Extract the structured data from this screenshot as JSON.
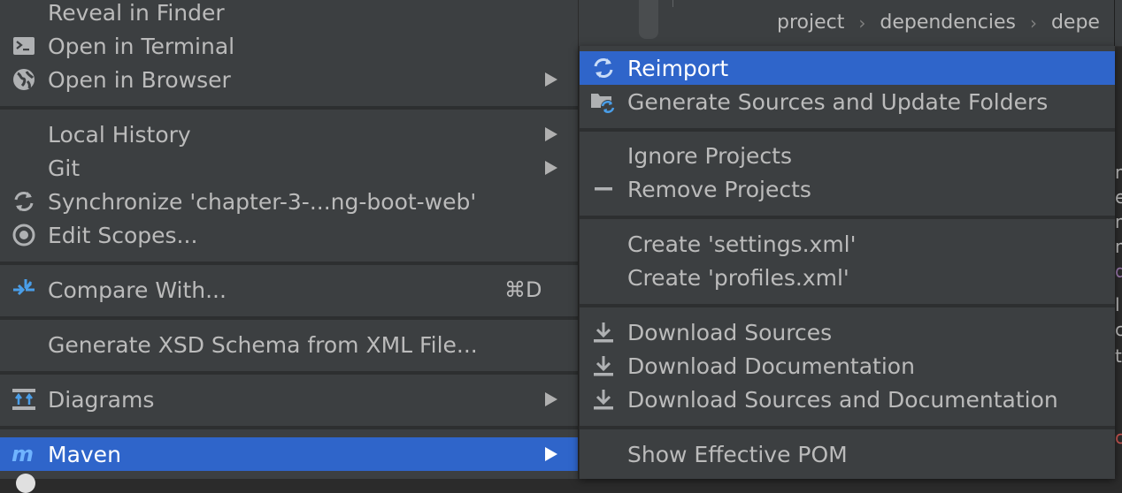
{
  "breadcrumb": [
    "project",
    "dependencies",
    "depe"
  ],
  "main_menu": {
    "items": [
      {
        "label": "Reveal in Finder",
        "icon": "",
        "submenu": false
      },
      {
        "label": "Open in Terminal",
        "icon": "terminal-icon",
        "submenu": false
      },
      {
        "label": "Open in Browser",
        "icon": "globe-icon",
        "submenu": true
      },
      {
        "label": "Local History",
        "icon": "",
        "submenu": true
      },
      {
        "label": "Git",
        "icon": "",
        "submenu": true
      },
      {
        "label": "Synchronize 'chapter-3-...ng-boot-web'",
        "icon": "sync-icon",
        "submenu": false
      },
      {
        "label": "Edit Scopes...",
        "icon": "scope-icon",
        "submenu": false
      },
      {
        "label": "Compare With...",
        "icon": "compare-icon",
        "submenu": false,
        "shortcut": "⌘D"
      },
      {
        "label": "Generate XSD Schema from XML File...",
        "icon": "",
        "submenu": false
      },
      {
        "label": "Diagrams",
        "icon": "diagram-icon",
        "submenu": true
      },
      {
        "label": "Maven",
        "icon": "maven-icon",
        "submenu": true,
        "selected": true
      }
    ]
  },
  "maven_menu": {
    "items": [
      {
        "label": "Reimport",
        "icon": "reimport-icon",
        "selected": true
      },
      {
        "label": "Generate Sources and Update Folders",
        "icon": "generate-sources-icon"
      },
      {
        "label": "Ignore Projects",
        "icon": ""
      },
      {
        "label": "Remove Projects",
        "icon": "minus-icon"
      },
      {
        "label": "Create 'settings.xml'",
        "icon": ""
      },
      {
        "label": "Create 'profiles.xml'",
        "icon": ""
      },
      {
        "label": "Download Sources",
        "icon": "download-icon"
      },
      {
        "label": "Download Documentation",
        "icon": "download-icon"
      },
      {
        "label": "Download Sources and Documentation",
        "icon": "download-icon"
      },
      {
        "label": "Show Effective POM",
        "icon": ""
      }
    ]
  },
  "right_strip_glyphs": [
    "m",
    "e",
    "m",
    "m",
    "g",
    "l",
    "c",
    "t",
    "c"
  ],
  "colors": {
    "menu_bg": "#3c3f41",
    "selection": "#2f65ca",
    "text": "#bbbbbb",
    "icon_blue": "#4a9ee8",
    "maven_blue": "#3d8fe0"
  }
}
